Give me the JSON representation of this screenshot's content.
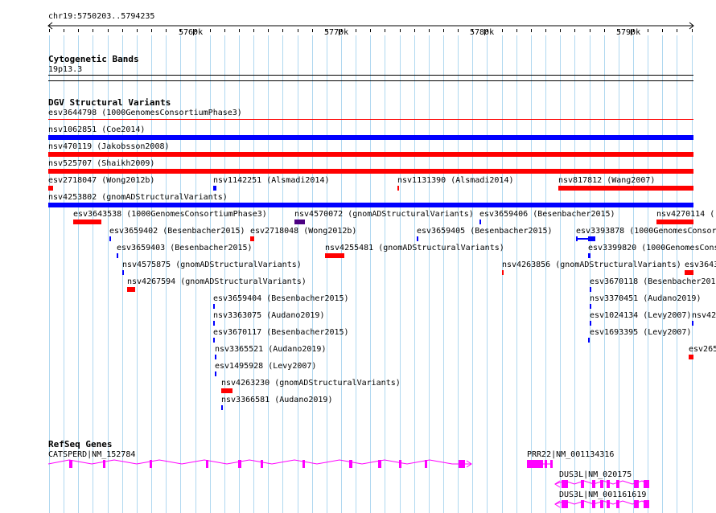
{
  "ruler": {
    "location": "chr19:5750203..5794235",
    "ticks": [
      "5760k",
      "5770k",
      "5780k",
      "5790k"
    ]
  },
  "tracks": {
    "cytoband": {
      "title": "Cytogenetic Bands",
      "label": "19p13.3"
    },
    "dgv": {
      "title": "DGV Structural Variants"
    },
    "refseq": {
      "title": "RefSeq Genes"
    }
  },
  "colors": {
    "gain": "#0000ff",
    "loss": "#ff0000",
    "gain_loss": "#4b0082",
    "exon": "#ff00ff",
    "grid": "#b0d8f0"
  },
  "variants": [
    "esv3644798 (1000GenomesConsortiumPhase3)",
    "nsv1062851 (Coe2014)",
    "nsv470119 (Jakobsson2008)",
    "nsv525707 (Shaikh2009)",
    "esv2718047 (Wong2012b)",
    "nsv1142251 (Alsmadi2014)",
    "nsv1131390 (Alsmadi2014)",
    "nsv817812 (Wang2007)",
    "nsv4253802 (gnomADStructuralVariants)",
    "esv3643538 (1000GenomesConsortiumPhase3)",
    "nsv4570072 (gnomADStructuralVariants)",
    "esv3659406 (Besenbacher2015)",
    "esv3659402 (Besenbacher2015)",
    "esv2718048 (Wong2012b)",
    "esv3659405 (Besenbacher2015)",
    "esv3393878 (1000GenomesConsor",
    "esv3659403 (Besenbacher2015)",
    "nsv4255481 (gnomADStructuralVariants)",
    "esv3399820 (1000GenomesCons",
    "nsv4575875 (gnomADStructuralVariants)",
    "nsv4263856 (gnomADStructuralVariants)",
    "esv3643",
    "nsv4267594 (gnomADStructuralVariants)",
    "esv3670118 (Besenbacher2015",
    "esv3659404 (Besenbacher2015)",
    "nsv3370451 (Audano2019)",
    "nsv3363075 (Audano2019)",
    "esv1024134 (Levy2007)",
    "nsv425",
    "esv3670117 (Besenbacher2015)",
    "esv1693395 (Levy2007)",
    "nsv3365521 (Audano2019)",
    "esv265",
    "esv1495928 (Levy2007)",
    "nsv4263230 (gnomADStructuralVariants)",
    "nsv3366581 (Audano2019)",
    "nsv4270114 ("
  ],
  "genes": [
    "CATSPERD|NM_152784",
    "PRR22|NM_001134316",
    "DUS3L|NM_020175",
    "DUS3L|NM_001161619"
  ]
}
